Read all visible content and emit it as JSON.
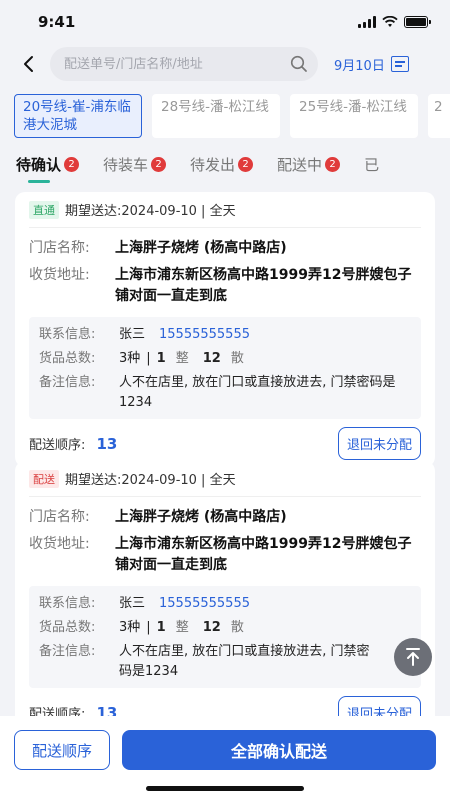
{
  "status_bar": {
    "time": "9:41"
  },
  "header": {
    "search_placeholder": "配送单号/门店名称/地址",
    "date_label": "9月10日",
    "icons": {
      "back": "back-arrow-icon",
      "search": "search-icon",
      "calendar": "calendar-icon"
    }
  },
  "routes": [
    {
      "label": "20号线-崔-浦东临港大泥城",
      "active": true
    },
    {
      "label": "28号线-潘-松江线",
      "active": false
    },
    {
      "label": "25号线-潘-松江线",
      "active": false
    },
    {
      "label": "2",
      "active": false
    }
  ],
  "tabs": [
    {
      "label": "待确认",
      "count": "2",
      "active": true
    },
    {
      "label": "待装车",
      "count": "2",
      "active": false
    },
    {
      "label": "待发出",
      "count": "2",
      "active": false
    },
    {
      "label": "配送中",
      "count": "2",
      "active": false
    },
    {
      "label": "已",
      "count": "",
      "active": false
    }
  ],
  "labels": {
    "store_name": "门店名称:",
    "address": "收货地址:",
    "contact": "联系信息:",
    "goods_total": "货品总数:",
    "remark": "备注信息:",
    "sequence": "配送顺序:",
    "return_btn": "退回未分配",
    "unit_whole": "整",
    "unit_loose": "散",
    "separator": "|"
  },
  "orders": [
    {
      "tag": "直通",
      "expected": "期望送达:2024-09-10 | 全天",
      "store_name": "上海胖子烧烤 (杨高中路店)",
      "address": "上海市浦东新区杨高中路1999弄12号胖嫂包子铺对面一直走到底",
      "contact_name": "张三",
      "contact_phone": "15555555555",
      "goods_kinds": "3种",
      "goods_whole": "1",
      "goods_loose": "12",
      "remark": "人不在店里, 放在门口或直接放进去, 门禁密码是1234",
      "sequence": "13"
    },
    {
      "tag": "配送",
      "expected": "期望送达:2024-09-10 | 全天",
      "store_name": "上海胖子烧烤 (杨高中路店)",
      "address": "上海市浦东新区杨高中路1999弄12号胖嫂包子铺对面一直走到底",
      "contact_name": "张三",
      "contact_phone": "15555555555",
      "goods_kinds": "3种",
      "goods_whole": "1",
      "goods_loose": "12",
      "remark": "人不在店里, 放在门口或直接放进去, 门禁密码是1234",
      "sequence": "13"
    }
  ],
  "footer": {
    "sequence_btn": "配送顺序",
    "confirm_btn": "全部确认配送"
  },
  "colors": {
    "primary": "#2a62d8",
    "accent_green": "#2bb39a",
    "badge_red": "#e03b3b"
  }
}
